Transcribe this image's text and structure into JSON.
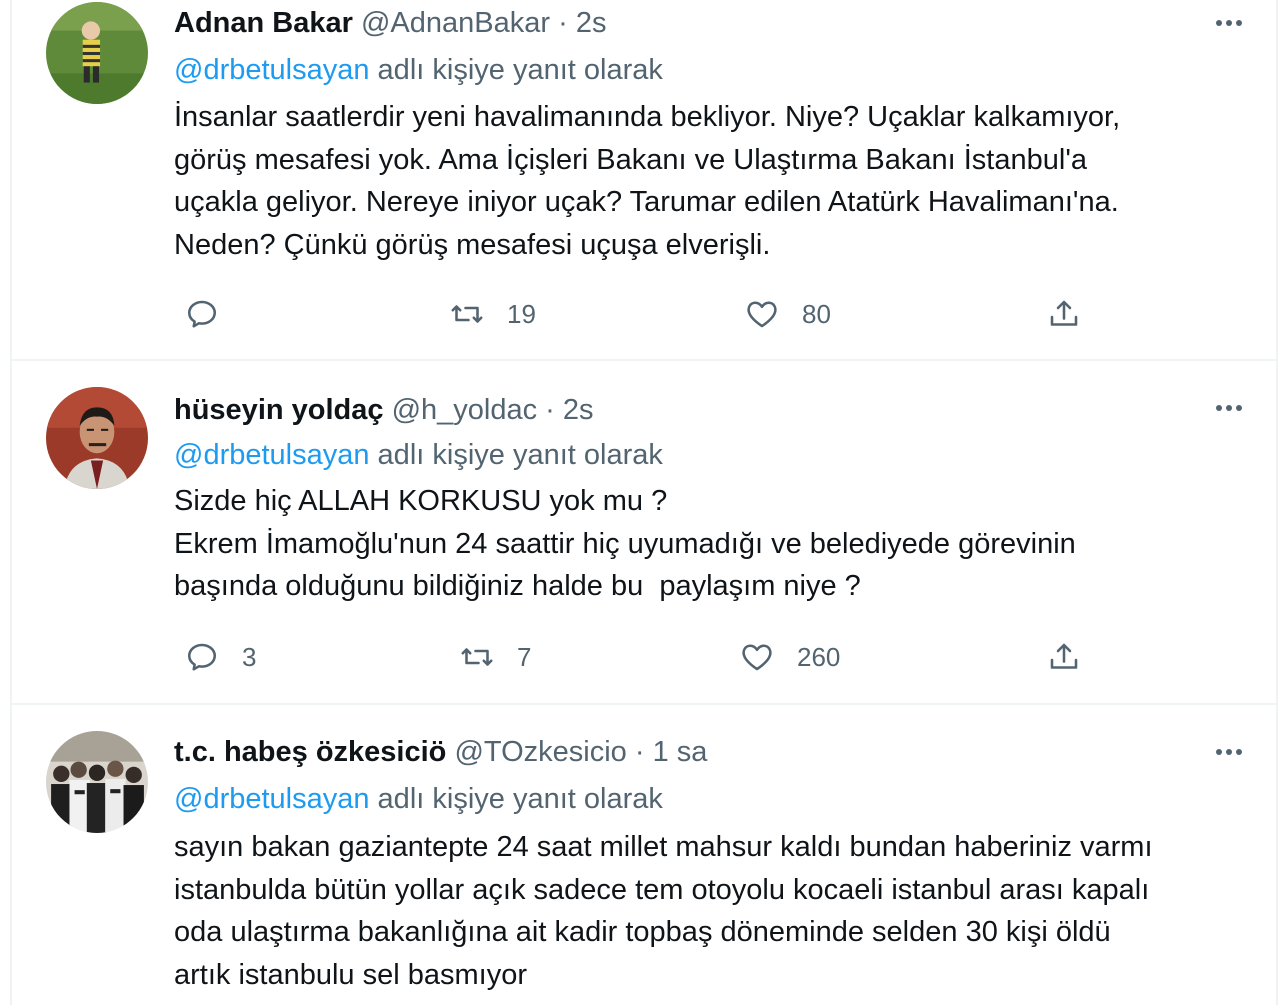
{
  "colors": {
    "accent": "#1d9bf0",
    "secondary_text": "#536471",
    "primary_text": "#0f1419",
    "border": "#eff3f4"
  },
  "tweets": [
    {
      "name": "Adnan Bakar",
      "handle": "@AdnanBakar",
      "separator": "·",
      "time": "2s",
      "replying_mention": "@drbetulsayan",
      "replying_text": " adlı kişiye yanıt olarak",
      "text_lines": [
        "İnsanlar saatlerdir yeni havalimanında bekliyor. Niye? Uçaklar kalkamıyor,",
        "görüş mesafesi yok. Ama İçişleri Bakanı ve Ulaştırma Bakanı İstanbul'a",
        "uçakla geliyor. Nereye iniyor uçak? Tarumar edilen Atatürk Havalimanı'na.",
        "Neden? Çünkü görüş mesafesi uçuşa elverişli."
      ],
      "reply_count": "",
      "retweet_count": "19",
      "like_count": "80",
      "avatar_icon": "avatar-child-in-field"
    },
    {
      "name": "hüseyin yoldaç",
      "handle": "@h_yoldac",
      "separator": "·",
      "time": "2s",
      "replying_mention": "@drbetulsayan",
      "replying_text": " adlı kişiye yanıt olarak",
      "text_lines": [
        "Sizde hiç ALLAH KORKUSU yok mu ?",
        "Ekrem İmamoğlu'nun 24 saattir hiç uyumadığı ve belediyede görevinin",
        "başında olduğunu bildiğiniz halde bu  paylaşım niye ?"
      ],
      "reply_count": "3",
      "retweet_count": "7",
      "like_count": "260",
      "avatar_icon": "avatar-man-portrait"
    },
    {
      "name": "t.c. habeş özkesiciö",
      "handle": "@TOzkesicio",
      "separator": "·",
      "time": "1 sa",
      "replying_mention": "@drbetulsayan",
      "replying_text": " adlı kişiye yanıt olarak",
      "text_lines": [
        "sayın bakan gaziantepte 24 saat millet mahsur kaldı bundan haberiniz varmı",
        "istanbulda bütün yollar açık sadece tem otoyolu kocaeli istanbul arası kapalı",
        "oda ulaştırma bakanlığına ait kadir topbaş döneminde selden 30 kişi öldü",
        "artık istanbulu sel basmıyor"
      ],
      "avatar_icon": "avatar-crowd"
    }
  ]
}
